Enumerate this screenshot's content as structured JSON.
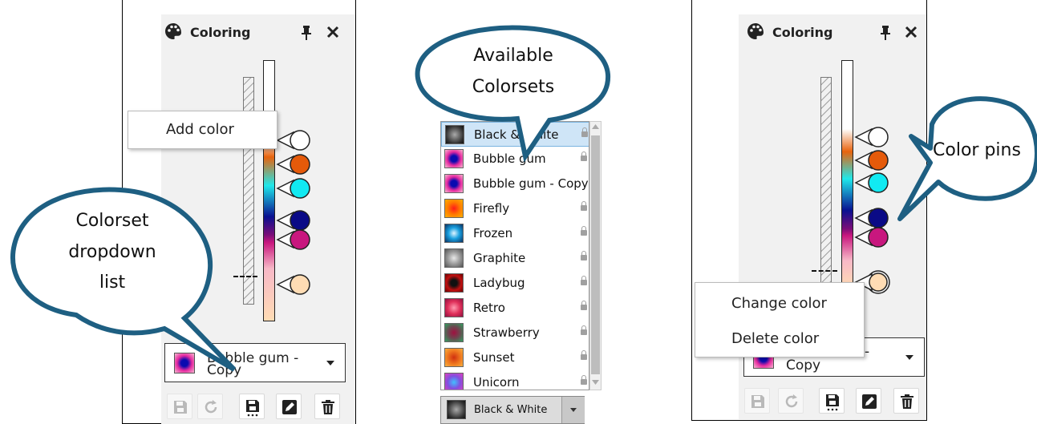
{
  "panel_left": {
    "title": "Coloring",
    "context_menu": {
      "add_color": "Add color"
    },
    "dropdown": {
      "selected": "Bubble gum - Copy"
    }
  },
  "colorsets": {
    "items": [
      {
        "label": "Black & White",
        "locked": true,
        "selected": true
      },
      {
        "label": "Bubble gum",
        "locked": true
      },
      {
        "label": "Bubble gum - Copy",
        "locked": false
      },
      {
        "label": "Firefly",
        "locked": true
      },
      {
        "label": "Frozen",
        "locked": true
      },
      {
        "label": "Graphite",
        "locked": true
      },
      {
        "label": "Ladybug",
        "locked": true
      },
      {
        "label": "Retro",
        "locked": true
      },
      {
        "label": "Strawberry",
        "locked": true
      },
      {
        "label": "Sunset",
        "locked": true
      },
      {
        "label": "Unicorn",
        "locked": true
      }
    ],
    "footer_selected": "Black & White"
  },
  "panel_right": {
    "title": "Coloring",
    "context_menu": {
      "change_color": "Change color",
      "delete_color": "Delete color"
    },
    "dropdown": {
      "selected_line1": "-",
      "selected_line2": "Copy"
    }
  },
  "callouts": {
    "colorset_dropdown_list": [
      "Colorset",
      "dropdown",
      "list"
    ],
    "available_colorsets": [
      "Available",
      "Colorsets"
    ],
    "color_pins": "Color pins"
  },
  "colors": {
    "accent_blue": "#1e5f82",
    "pin_colors": [
      "#ffffff",
      "#e55a0a",
      "#11eaf2",
      "#0a0a86",
      "#c8177e",
      "#ffdcb4"
    ]
  }
}
